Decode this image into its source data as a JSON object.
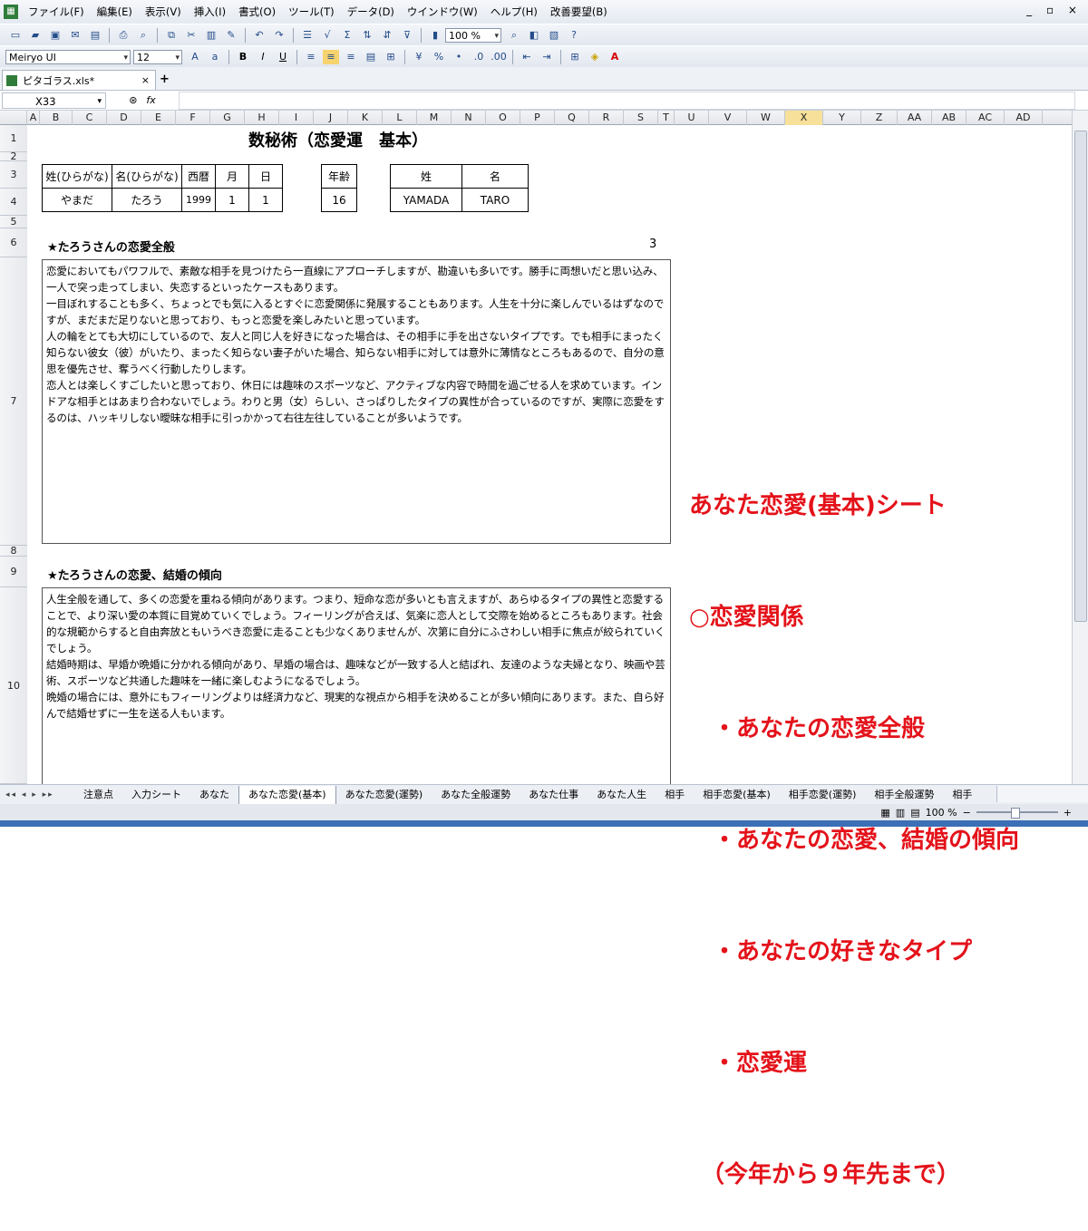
{
  "menubar": {
    "items": [
      "ファイル(F)",
      "編集(E)",
      "表示(V)",
      "挿入(I)",
      "書式(O)",
      "ツール(T)",
      "データ(D)",
      "ウインドウ(W)",
      "ヘルプ(H)",
      "改善要望(B)"
    ],
    "window_controls": "_ ▫ ×"
  },
  "toolbar": {
    "font_name": "Meiryo UI",
    "font_size": "12",
    "zoom": "100 %",
    "bold": "B",
    "italic": "I",
    "underline": "U"
  },
  "document": {
    "tab_title": "ピタゴラス.xls*",
    "close": "×",
    "new_tab": "+"
  },
  "formula_bar": {
    "cell_ref": "X33",
    "fx": "fx"
  },
  "columns": [
    "A",
    "B",
    "C",
    "D",
    "E",
    "F",
    "G",
    "H",
    "I",
    "J",
    "K",
    "L",
    "M",
    "N",
    "O",
    "P",
    "Q",
    "R",
    "S",
    "T",
    "U",
    "V",
    "W",
    "X",
    "Y",
    "Z",
    "AA",
    "AB",
    "AC",
    "AD"
  ],
  "rows": [
    "1",
    "2",
    "3",
    "4",
    "5",
    "6",
    "7",
    "8",
    "9",
    "10"
  ],
  "sheet": {
    "title": "数秘術（恋愛運　基本）",
    "info_headers": [
      "姓(ひらがな)",
      "名(ひらがな)",
      "西暦",
      "月",
      "日"
    ],
    "info_values": [
      "やまだ",
      "たろう",
      "1999",
      "1",
      "1"
    ],
    "age_header": "年齢",
    "age_value": "16",
    "name_headers": [
      "姓",
      "名"
    ],
    "name_values": [
      "YAMADA",
      "TARO"
    ],
    "section1_title": "★たろうさんの恋愛全般",
    "section1_number": "3",
    "section1_text": "恋愛においてもパワフルで、素敵な相手を見つけたら一直線にアプローチしますが、勘違いも多いです。勝手に両想いだと思い込み、一人で突っ走ってしまい、失恋するといったケースもあります。\n一目ぼれすることも多く、ちょっとでも気に入るとすぐに恋愛関係に発展することもあります。人生を十分に楽しんでいるはずなのですが、まだまだ足りないと思っており、もっと恋愛を楽しみたいと思っています。\n人の輪をとても大切にしているので、友人と同じ人を好きになった場合は、その相手に手を出さないタイプです。でも相手にまったく知らない彼女（彼）がいたり、まったく知らない妻子がいた場合、知らない相手に対しては意外に薄情なところもあるので、自分の意思を優先させ、奪うべく行動したりします。\n恋人とは楽しくすごしたいと思っており、休日には趣味のスポーツなど、アクティブな内容で時間を過ごせる人を求めています。インドアな相手とはあまり合わないでしょう。わりと男（女）らしい、さっぱりしたタイプの異性が合っているのですが、実際に恋愛をするのは、ハッキリしない曖昧な相手に引っかかって右往左往していることが多いようです。",
    "section2_title": "★たろうさんの恋愛、結婚の傾向",
    "section2_text": "人生全般を通して、多くの恋愛を重ねる傾向があります。つまり、短命な恋が多いとも言えますが、あらゆるタイプの異性と恋愛することで、より深い愛の本質に目覚めていくでしょう。フィーリングが合えば、気楽に恋人として交際を始めるところもあります。社会的な規範からすると自由奔放ともいうべき恋愛に走ることも少なくありませんが、次第に自分にふさわしい相手に焦点が絞られていくでしょう。\n結婚時期は、早婚か晩婚に分かれる傾向があり、早婚の場合は、趣味などが一致する人と結ばれ、友達のような夫婦となり、映画や芸術、スポーツなど共通した趣味を一緒に楽しむようになるでしょう。\n晩婚の場合には、意外にもフィーリングよりは経済力など、現実的な視点から相手を決めることが多い傾向にあります。また、自ら好んで結婚せずに一生を送る人もいます。"
  },
  "overlay": {
    "line1": "あなた恋愛(基本)シート",
    "line2": "○恋愛関係",
    "line3": "　・あなたの恋愛全般",
    "line4": "　・あなたの恋愛、結婚の傾向",
    "line5": "　・あなたの好きなタイプ",
    "line6": "　・恋愛運",
    "line7": "　（今年から９年先まで）",
    "color": "#e4121a"
  },
  "sheet_tabs": [
    "注意点",
    "入力シート",
    "あなた",
    "あなた恋愛(基本)",
    "あなた恋愛(運勢)",
    "あなた全般運勢",
    "あなた仕事",
    "あなた人生",
    "相手",
    "相手恋愛(基本)",
    "相手恋愛(運勢)",
    "相手全般運勢",
    "相手"
  ],
  "active_sheet": "あなた恋愛(基本)",
  "status": {
    "zoom": "100 %"
  }
}
